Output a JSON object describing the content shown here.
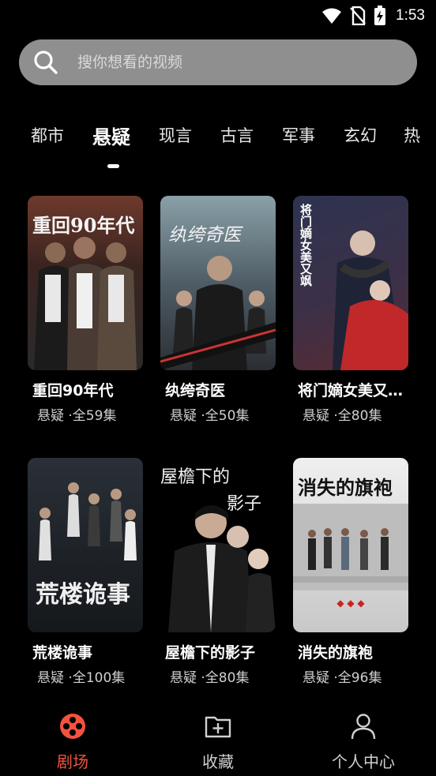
{
  "status_bar": {
    "time": "1:53"
  },
  "search": {
    "placeholder": "搜你想看的视频"
  },
  "tabs": [
    "都市",
    "悬疑",
    "现言",
    "古言",
    "军事",
    "玄幻",
    "热"
  ],
  "active_tab": "悬疑",
  "dramas": [
    {
      "title": "重回90年代",
      "genre": "悬疑",
      "episodes": "·全59集",
      "cover_text": "重回90年代"
    },
    {
      "title": "纨绔奇医",
      "genre": "悬疑",
      "episodes": "·全50集",
      "cover_text": "纨绔奇医"
    },
    {
      "title": "将门嫡女美又…",
      "genre": "悬疑",
      "episodes": "·全80集",
      "cover_text": "将门嫡女美又飒"
    },
    {
      "title": "荒楼诡事",
      "genre": "悬疑",
      "episodes": "·全100集",
      "cover_text": "荒楼诡事"
    },
    {
      "title": "屋檐下的影子",
      "genre": "悬疑",
      "episodes": "·全80集",
      "cover_text_1": "屋檐下的",
      "cover_text_2": "影子"
    },
    {
      "title": "消失的旗袍",
      "genre": "悬疑",
      "episodes": "·全96集",
      "cover_text": "消失的旗袍"
    }
  ],
  "bottom_nav": [
    {
      "label": "剧场",
      "icon": "film-reel-icon",
      "active": true
    },
    {
      "label": "收藏",
      "icon": "folder-add-icon",
      "active": false
    },
    {
      "label": "个人中心",
      "icon": "user-icon",
      "active": false
    }
  ],
  "colors": {
    "accent": "#f3523f",
    "background": "#000000",
    "search_bg": "#8f8f8f"
  }
}
